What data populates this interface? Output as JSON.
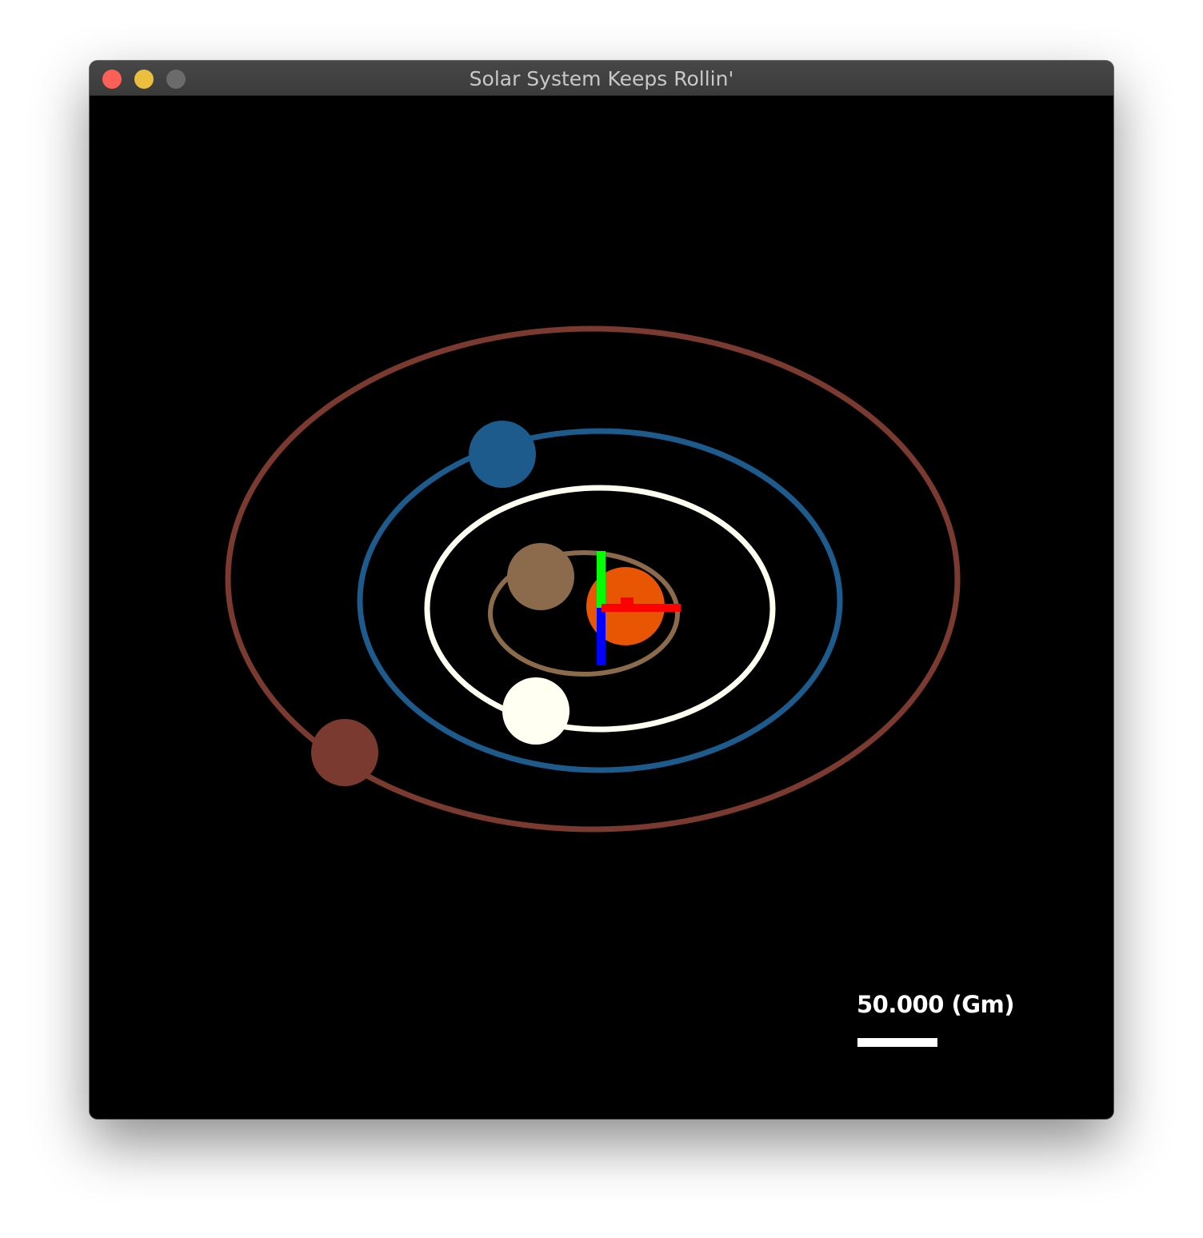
{
  "window": {
    "title": "Solar System Keeps Rollin'",
    "buttons": [
      "close",
      "minimize",
      "zoom"
    ]
  },
  "scene": {
    "background_color": "#000000",
    "sun_color": "#e85503",
    "bodies": [
      {
        "name": "inner-planet",
        "color": "#8b6b4b"
      },
      {
        "name": "second-planet",
        "color": "#fffff2"
      },
      {
        "name": "third-planet",
        "color": "#1d5b8d"
      },
      {
        "name": "outer-planet",
        "color": "#7a3a30"
      }
    ],
    "axes": {
      "x_color": "#ff0000",
      "y_color": "#00ff00",
      "z_color": "#0000ff"
    }
  },
  "scale": {
    "label": "50.000 (Gm)",
    "bar_color": "#ffffff"
  }
}
